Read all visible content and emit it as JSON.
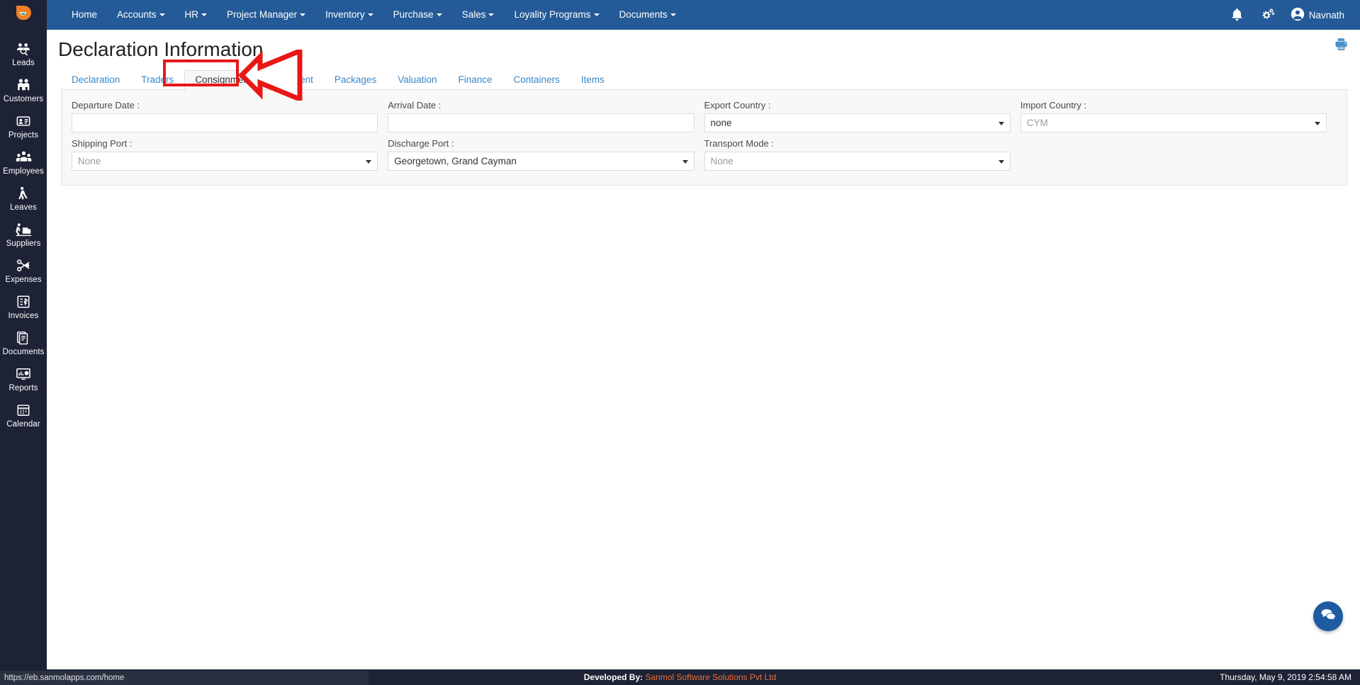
{
  "brand": {
    "logo_icon": "app-logo-icon",
    "accent": "#e8782d",
    "navbar_color": "#235a97",
    "sidebar_color": "#1d2235"
  },
  "sidebar": {
    "items": [
      {
        "icon": "leads-icon",
        "label": "Leads"
      },
      {
        "icon": "customers-icon",
        "label": "Customers"
      },
      {
        "icon": "projects-icon",
        "label": "Projects"
      },
      {
        "icon": "employees-icon",
        "label": "Employees"
      },
      {
        "icon": "leaves-icon",
        "label": "Leaves"
      },
      {
        "icon": "suppliers-icon",
        "label": "Suppliers"
      },
      {
        "icon": "expenses-icon",
        "label": "Expenses"
      },
      {
        "icon": "invoices-icon",
        "label": "Invoices"
      },
      {
        "icon": "documents-icon",
        "label": "Documents"
      },
      {
        "icon": "reports-icon",
        "label": "Reports"
      },
      {
        "icon": "calendar-icon",
        "label": "Calendar"
      }
    ]
  },
  "topnav": {
    "items": [
      {
        "label": "Home",
        "has_caret": false
      },
      {
        "label": "Accounts",
        "has_caret": true
      },
      {
        "label": "HR",
        "has_caret": true
      },
      {
        "label": "Project Manager",
        "has_caret": true
      },
      {
        "label": "Inventory",
        "has_caret": true
      },
      {
        "label": "Purchase",
        "has_caret": true
      },
      {
        "label": "Sales",
        "has_caret": true
      },
      {
        "label": "Loyality Programs",
        "has_caret": true
      },
      {
        "label": "Documents",
        "has_caret": true
      }
    ],
    "notification_icon": "bell-icon",
    "settings_icon": "gears-icon",
    "user": {
      "name": "Navnath",
      "avatar_icon": "user-circle-icon"
    }
  },
  "page": {
    "title": "Declaration Information",
    "print_icon": "printer-icon"
  },
  "tabs": [
    {
      "label": "Declaration",
      "active": false
    },
    {
      "label": "Traders",
      "active": false
    },
    {
      "label": "Consignment",
      "active": true
    },
    {
      "label": "Shipment",
      "active": false
    },
    {
      "label": "Packages",
      "active": false
    },
    {
      "label": "Valuation",
      "active": false
    },
    {
      "label": "Finance",
      "active": false
    },
    {
      "label": "Containers",
      "active": false
    },
    {
      "label": "Items",
      "active": false
    }
  ],
  "form": {
    "row1": [
      {
        "label": "Departure Date :",
        "type": "input",
        "value": "",
        "placeholder": ""
      },
      {
        "label": "Arrival Date :",
        "type": "input",
        "value": "",
        "placeholder": ""
      },
      {
        "label": "Export Country :",
        "type": "select",
        "value": "none",
        "muted": false
      },
      {
        "label": "Import Country :",
        "type": "select",
        "value": "CYM",
        "muted": true
      }
    ],
    "row2": [
      {
        "label": "Shipping Port :",
        "type": "select",
        "value": "None",
        "muted": true
      },
      {
        "label": "Discharge Port :",
        "type": "select",
        "value": "Georgetown, Grand Cayman",
        "muted": false
      },
      {
        "label": "Transport Mode :",
        "type": "select",
        "value": "None",
        "muted": true
      }
    ]
  },
  "annotation": {
    "highlight_target": "Consignment",
    "color": "#e81717",
    "shape": "box-and-left-arrow"
  },
  "chat": {
    "icon": "chat-bubbles-icon"
  },
  "footer": {
    "developed_by_label": "Developed By:",
    "company": "Sanmol Software Solutions Pvt Ltd",
    "datetime": "Thursday, May 9, 2019 2:54:58 AM"
  },
  "statusbar": {
    "url": "https://eb.sanmolapps.com/home"
  }
}
